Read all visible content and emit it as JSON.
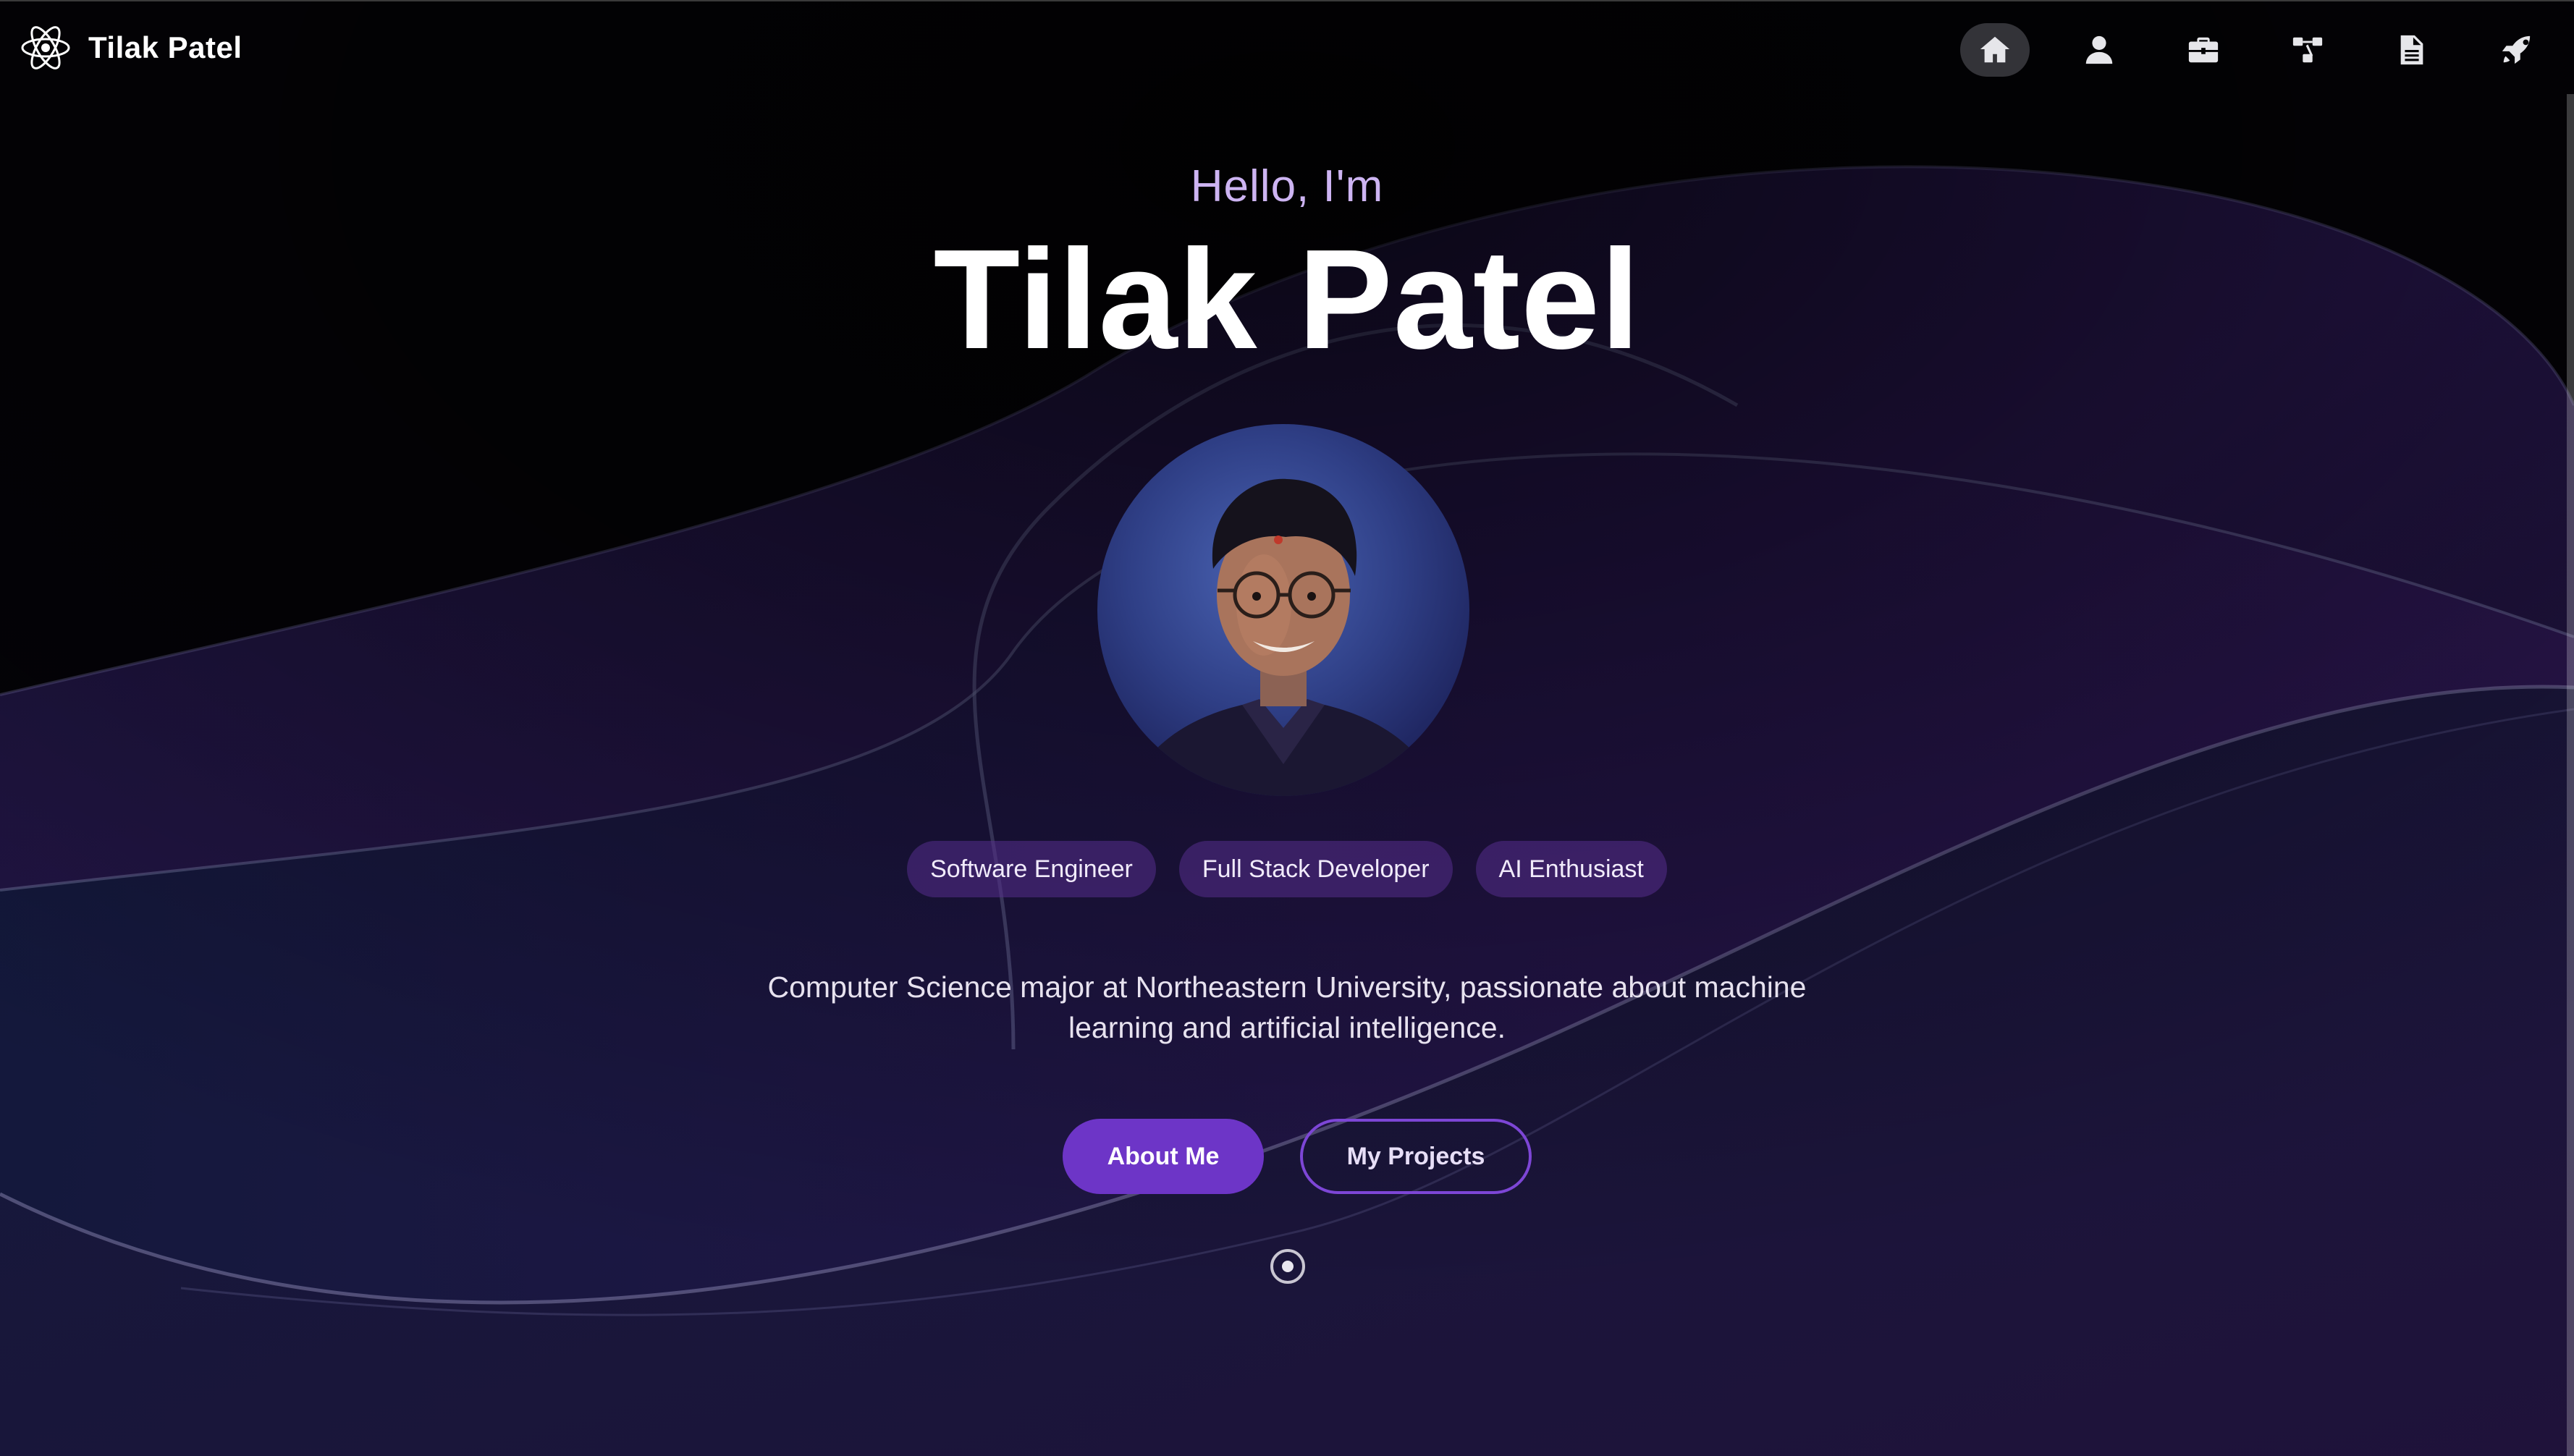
{
  "header": {
    "brand_name": "Tilak Patel",
    "brand_icon": "atom-icon",
    "nav_items": [
      {
        "icon": "home-icon",
        "active": true
      },
      {
        "icon": "user-icon",
        "active": false
      },
      {
        "icon": "briefcase-icon",
        "active": false
      },
      {
        "icon": "sitemap-icon",
        "active": false
      },
      {
        "icon": "document-icon",
        "active": false
      },
      {
        "icon": "rocket-icon",
        "active": false
      }
    ]
  },
  "hero": {
    "greeting": "Hello, I'm",
    "name": "Tilak Patel",
    "tags": [
      "Software Engineer",
      "Full Stack Developer",
      "AI Enthusiast"
    ],
    "description": "Computer Science major at Northeastern University, passionate about machine learning and artificial intelligence.",
    "primary_button": "About Me",
    "secondary_button": "My Projects"
  },
  "theme": {
    "background": "#050308",
    "accent": "#6d35c7",
    "greeting_color": "#cdb4f2"
  }
}
